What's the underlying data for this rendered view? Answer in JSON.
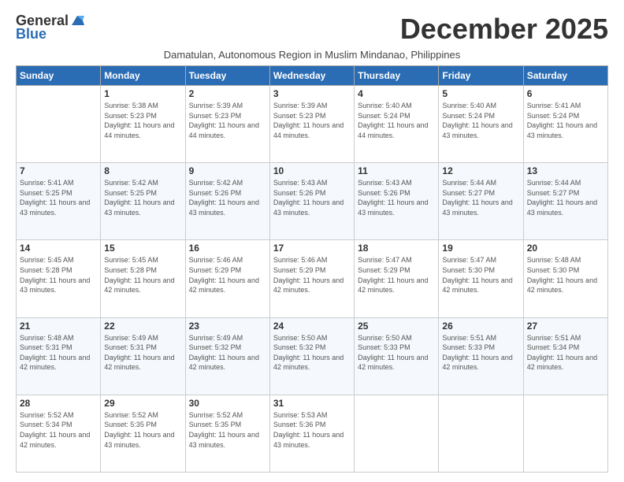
{
  "logo": {
    "general": "General",
    "blue": "Blue"
  },
  "header": {
    "month": "December 2025",
    "subtitle": "Damatulan, Autonomous Region in Muslim Mindanao, Philippines"
  },
  "weekdays": [
    "Sunday",
    "Monday",
    "Tuesday",
    "Wednesday",
    "Thursday",
    "Friday",
    "Saturday"
  ],
  "weeks": [
    [
      {
        "day": "",
        "sunrise": "",
        "sunset": "",
        "daylight": ""
      },
      {
        "day": "1",
        "sunrise": "Sunrise: 5:38 AM",
        "sunset": "Sunset: 5:23 PM",
        "daylight": "Daylight: 11 hours and 44 minutes."
      },
      {
        "day": "2",
        "sunrise": "Sunrise: 5:39 AM",
        "sunset": "Sunset: 5:23 PM",
        "daylight": "Daylight: 11 hours and 44 minutes."
      },
      {
        "day": "3",
        "sunrise": "Sunrise: 5:39 AM",
        "sunset": "Sunset: 5:23 PM",
        "daylight": "Daylight: 11 hours and 44 minutes."
      },
      {
        "day": "4",
        "sunrise": "Sunrise: 5:40 AM",
        "sunset": "Sunset: 5:24 PM",
        "daylight": "Daylight: 11 hours and 44 minutes."
      },
      {
        "day": "5",
        "sunrise": "Sunrise: 5:40 AM",
        "sunset": "Sunset: 5:24 PM",
        "daylight": "Daylight: 11 hours and 43 minutes."
      },
      {
        "day": "6",
        "sunrise": "Sunrise: 5:41 AM",
        "sunset": "Sunset: 5:24 PM",
        "daylight": "Daylight: 11 hours and 43 minutes."
      }
    ],
    [
      {
        "day": "7",
        "sunrise": "Sunrise: 5:41 AM",
        "sunset": "Sunset: 5:25 PM",
        "daylight": "Daylight: 11 hours and 43 minutes."
      },
      {
        "day": "8",
        "sunrise": "Sunrise: 5:42 AM",
        "sunset": "Sunset: 5:25 PM",
        "daylight": "Daylight: 11 hours and 43 minutes."
      },
      {
        "day": "9",
        "sunrise": "Sunrise: 5:42 AM",
        "sunset": "Sunset: 5:26 PM",
        "daylight": "Daylight: 11 hours and 43 minutes."
      },
      {
        "day": "10",
        "sunrise": "Sunrise: 5:43 AM",
        "sunset": "Sunset: 5:26 PM",
        "daylight": "Daylight: 11 hours and 43 minutes."
      },
      {
        "day": "11",
        "sunrise": "Sunrise: 5:43 AM",
        "sunset": "Sunset: 5:26 PM",
        "daylight": "Daylight: 11 hours and 43 minutes."
      },
      {
        "day": "12",
        "sunrise": "Sunrise: 5:44 AM",
        "sunset": "Sunset: 5:27 PM",
        "daylight": "Daylight: 11 hours and 43 minutes."
      },
      {
        "day": "13",
        "sunrise": "Sunrise: 5:44 AM",
        "sunset": "Sunset: 5:27 PM",
        "daylight": "Daylight: 11 hours and 43 minutes."
      }
    ],
    [
      {
        "day": "14",
        "sunrise": "Sunrise: 5:45 AM",
        "sunset": "Sunset: 5:28 PM",
        "daylight": "Daylight: 11 hours and 43 minutes."
      },
      {
        "day": "15",
        "sunrise": "Sunrise: 5:45 AM",
        "sunset": "Sunset: 5:28 PM",
        "daylight": "Daylight: 11 hours and 42 minutes."
      },
      {
        "day": "16",
        "sunrise": "Sunrise: 5:46 AM",
        "sunset": "Sunset: 5:29 PM",
        "daylight": "Daylight: 11 hours and 42 minutes."
      },
      {
        "day": "17",
        "sunrise": "Sunrise: 5:46 AM",
        "sunset": "Sunset: 5:29 PM",
        "daylight": "Daylight: 11 hours and 42 minutes."
      },
      {
        "day": "18",
        "sunrise": "Sunrise: 5:47 AM",
        "sunset": "Sunset: 5:29 PM",
        "daylight": "Daylight: 11 hours and 42 minutes."
      },
      {
        "day": "19",
        "sunrise": "Sunrise: 5:47 AM",
        "sunset": "Sunset: 5:30 PM",
        "daylight": "Daylight: 11 hours and 42 minutes."
      },
      {
        "day": "20",
        "sunrise": "Sunrise: 5:48 AM",
        "sunset": "Sunset: 5:30 PM",
        "daylight": "Daylight: 11 hours and 42 minutes."
      }
    ],
    [
      {
        "day": "21",
        "sunrise": "Sunrise: 5:48 AM",
        "sunset": "Sunset: 5:31 PM",
        "daylight": "Daylight: 11 hours and 42 minutes."
      },
      {
        "day": "22",
        "sunrise": "Sunrise: 5:49 AM",
        "sunset": "Sunset: 5:31 PM",
        "daylight": "Daylight: 11 hours and 42 minutes."
      },
      {
        "day": "23",
        "sunrise": "Sunrise: 5:49 AM",
        "sunset": "Sunset: 5:32 PM",
        "daylight": "Daylight: 11 hours and 42 minutes."
      },
      {
        "day": "24",
        "sunrise": "Sunrise: 5:50 AM",
        "sunset": "Sunset: 5:32 PM",
        "daylight": "Daylight: 11 hours and 42 minutes."
      },
      {
        "day": "25",
        "sunrise": "Sunrise: 5:50 AM",
        "sunset": "Sunset: 5:33 PM",
        "daylight": "Daylight: 11 hours and 42 minutes."
      },
      {
        "day": "26",
        "sunrise": "Sunrise: 5:51 AM",
        "sunset": "Sunset: 5:33 PM",
        "daylight": "Daylight: 11 hours and 42 minutes."
      },
      {
        "day": "27",
        "sunrise": "Sunrise: 5:51 AM",
        "sunset": "Sunset: 5:34 PM",
        "daylight": "Daylight: 11 hours and 42 minutes."
      }
    ],
    [
      {
        "day": "28",
        "sunrise": "Sunrise: 5:52 AM",
        "sunset": "Sunset: 5:34 PM",
        "daylight": "Daylight: 11 hours and 42 minutes."
      },
      {
        "day": "29",
        "sunrise": "Sunrise: 5:52 AM",
        "sunset": "Sunset: 5:35 PM",
        "daylight": "Daylight: 11 hours and 43 minutes."
      },
      {
        "day": "30",
        "sunrise": "Sunrise: 5:52 AM",
        "sunset": "Sunset: 5:35 PM",
        "daylight": "Daylight: 11 hours and 43 minutes."
      },
      {
        "day": "31",
        "sunrise": "Sunrise: 5:53 AM",
        "sunset": "Sunset: 5:36 PM",
        "daylight": "Daylight: 11 hours and 43 minutes."
      },
      {
        "day": "",
        "sunrise": "",
        "sunset": "",
        "daylight": ""
      },
      {
        "day": "",
        "sunrise": "",
        "sunset": "",
        "daylight": ""
      },
      {
        "day": "",
        "sunrise": "",
        "sunset": "",
        "daylight": ""
      }
    ]
  ]
}
